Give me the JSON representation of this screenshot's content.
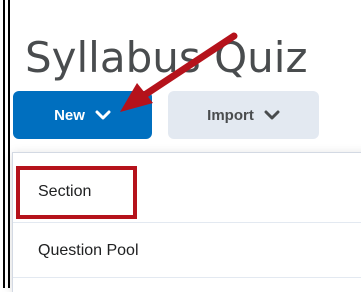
{
  "page": {
    "title": "Syllabus Quiz"
  },
  "toolbar": {
    "new_label": "New",
    "import_label": "Import"
  },
  "menu": {
    "items": [
      {
        "label": "Section"
      },
      {
        "label": "Question Pool"
      }
    ]
  },
  "annotations": {
    "highlight_color": "#b5121b",
    "arrow_color": "#b5121b"
  }
}
